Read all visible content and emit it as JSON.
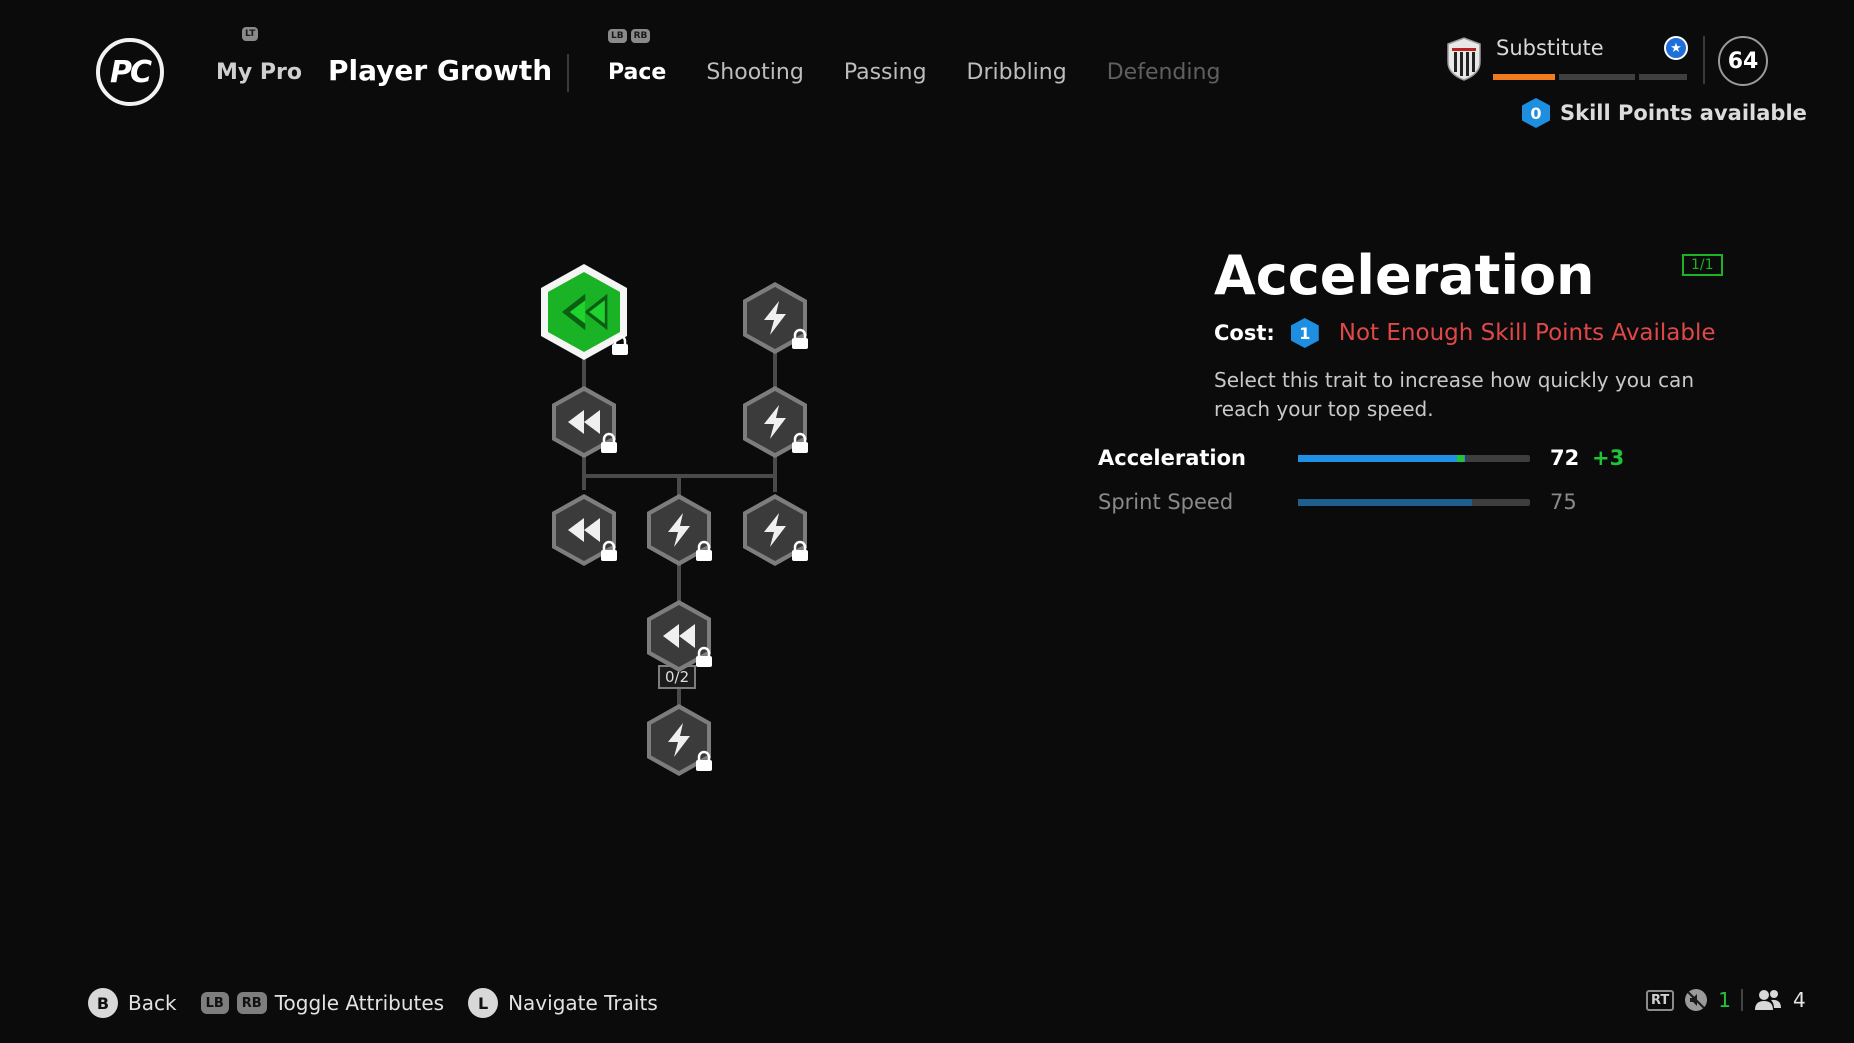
{
  "header": {
    "logo_text": "PC",
    "hint_lt": "LT",
    "hint_lb": "LB",
    "hint_rb": "RB",
    "nav_my_pro": "My Pro",
    "page_title": "Player Growth",
    "tabs": [
      {
        "label": "Pace",
        "state": "active"
      },
      {
        "label": "Shooting",
        "state": "normal"
      },
      {
        "label": "Passing",
        "state": "normal"
      },
      {
        "label": "Dribbling",
        "state": "normal"
      },
      {
        "label": "Defending",
        "state": "disabled"
      }
    ],
    "role": "Substitute",
    "role_progress_segments": [
      {
        "fill": 1.0
      },
      {
        "fill": 0.0
      },
      {
        "fill": 0.0
      },
      {
        "fill": 0.0
      }
    ],
    "overall_rating": "64",
    "skill_points_count": "0",
    "skill_points_label": "Skill Points available"
  },
  "tree": {
    "nodes": [
      {
        "id": "accel-1",
        "icon": "rewind-icon",
        "state": "selected",
        "locked": true
      },
      {
        "id": "bolt-top",
        "icon": "lightning-icon",
        "state": "locked",
        "locked": true
      },
      {
        "id": "accel-2",
        "icon": "rewind-icon",
        "state": "locked",
        "locked": true
      },
      {
        "id": "bolt-2",
        "icon": "lightning-icon",
        "state": "locked",
        "locked": true
      },
      {
        "id": "accel-3",
        "icon": "rewind-icon",
        "state": "locked",
        "locked": true
      },
      {
        "id": "bolt-mid",
        "icon": "lightning-icon",
        "state": "locked",
        "locked": true
      },
      {
        "id": "bolt-3",
        "icon": "lightning-icon",
        "state": "locked",
        "locked": true
      },
      {
        "id": "accel-4",
        "icon": "rewind-icon",
        "state": "locked",
        "locked": true
      },
      {
        "id": "bolt-bottom",
        "icon": "lightning-icon",
        "state": "locked",
        "locked": true
      }
    ],
    "accel4_counter": "0/2"
  },
  "detail": {
    "title": "Acceleration",
    "count_tag": "1/1",
    "cost_label": "Cost:",
    "cost_value": "1",
    "cost_warning": "Not Enough Skill Points Available",
    "description": "Select this trait to increase how quickly you can reach your top speed.",
    "attributes": [
      {
        "name": "Acceleration",
        "value": "72",
        "boost": "+3",
        "fill": 0.72,
        "boost_fill": 0.03,
        "highlight": true
      },
      {
        "name": "Sprint Speed",
        "value": "75",
        "boost": "",
        "fill": 0.75,
        "boost_fill": 0,
        "highlight": false
      }
    ]
  },
  "footer": {
    "back_button": "B",
    "back_label": "Back",
    "toggle_lb": "LB",
    "toggle_rb": "RB",
    "toggle_label": "Toggle Attributes",
    "navigate_button": "L",
    "navigate_label": "Navigate Traits",
    "rt_label": "RT",
    "mic_count": "1",
    "party_count": "4"
  },
  "colors": {
    "accent_green": "#19b325",
    "warning_red": "#e04848",
    "skill_blue": "#1e8ee0",
    "bar_blue": "#1e90e6",
    "role_orange": "#f07a1e"
  }
}
